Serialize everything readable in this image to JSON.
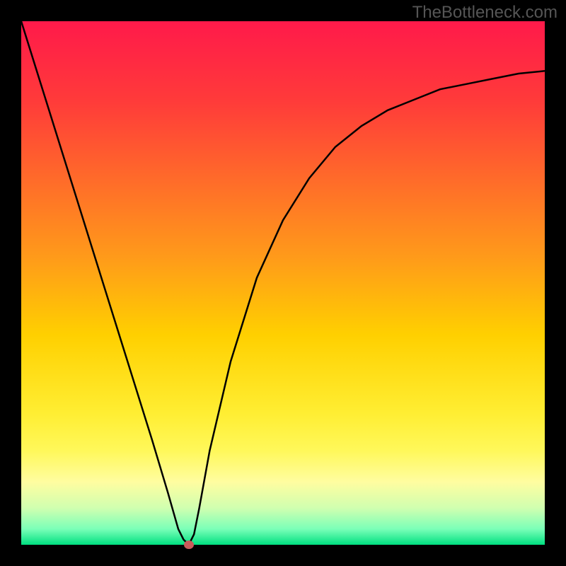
{
  "watermark": "TheBottleneck.com",
  "chart_data": {
    "type": "line",
    "title": "",
    "xlabel": "",
    "ylabel": "",
    "xlim": [
      0,
      100
    ],
    "ylim": [
      0,
      100
    ],
    "grid": false,
    "legend": false,
    "background_gradient": {
      "stops": [
        {
          "pos": 0.0,
          "color": "#ff1a4a"
        },
        {
          "pos": 0.15,
          "color": "#ff3a3a"
        },
        {
          "pos": 0.3,
          "color": "#ff6a2a"
        },
        {
          "pos": 0.45,
          "color": "#ff9a1a"
        },
        {
          "pos": 0.6,
          "color": "#ffd000"
        },
        {
          "pos": 0.75,
          "color": "#ffee33"
        },
        {
          "pos": 0.82,
          "color": "#fff85a"
        },
        {
          "pos": 0.88,
          "color": "#fffda0"
        },
        {
          "pos": 0.93,
          "color": "#d0ffb0"
        },
        {
          "pos": 0.97,
          "color": "#7affb8"
        },
        {
          "pos": 1.0,
          "color": "#00e080"
        }
      ]
    },
    "series": [
      {
        "name": "bottleneck-curve",
        "x": [
          0,
          5,
          10,
          15,
          20,
          25,
          28,
          30,
          31,
          32,
          33,
          34,
          36,
          40,
          45,
          50,
          55,
          60,
          65,
          70,
          75,
          80,
          85,
          90,
          95,
          100
        ],
        "y": [
          100,
          84,
          68,
          52,
          36,
          20,
          10,
          3,
          1,
          0,
          2,
          7,
          18,
          35,
          51,
          62,
          70,
          76,
          80,
          83,
          85,
          87,
          88,
          89,
          90,
          90.5
        ]
      }
    ],
    "marker": {
      "x": 32,
      "y": 0,
      "color": "#c95a5a"
    }
  }
}
